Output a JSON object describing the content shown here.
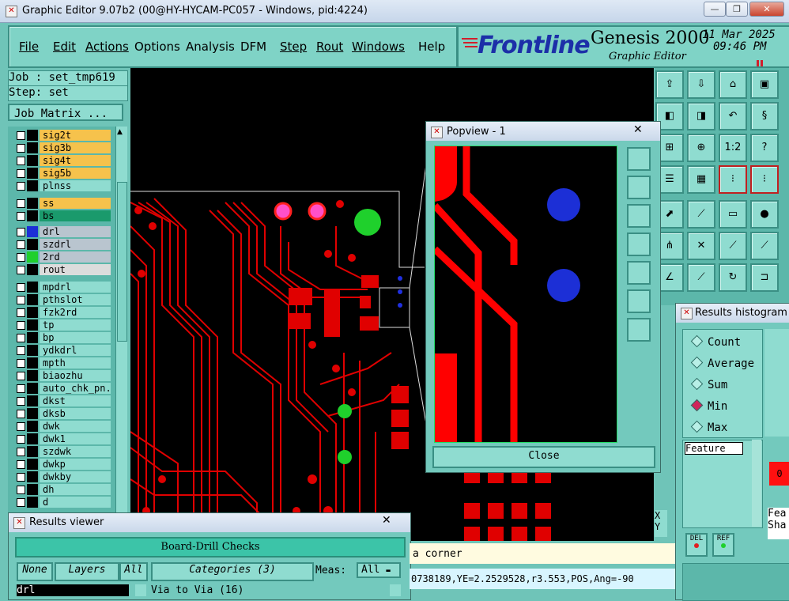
{
  "window": {
    "title": "Graphic Editor 9.07b2 (00@HY-HYCAM-PC057 - Windows, pid:4224)"
  },
  "menu": [
    "File",
    "Edit",
    "Actions",
    "Options",
    "Analysis",
    "DFM",
    "Step",
    "Rout",
    "Windows",
    "Help"
  ],
  "brand": {
    "logo": "Frontline",
    "product": "Genesis 2000",
    "subtitle": "Graphic Editor",
    "date": "11 Mar 2025",
    "time": "09:46 PM"
  },
  "job": {
    "job_label": "Job : set_tmp619",
    "step_label": "Step: set",
    "matrix_button": "Job Matrix ..."
  },
  "layers": [
    {
      "name": "sig2t",
      "color": "#f6c24c",
      "swatch": "#000"
    },
    {
      "name": "sig3b",
      "color": "#f6c24c",
      "swatch": "#000"
    },
    {
      "name": "sig4t",
      "color": "#f6c24c",
      "swatch": "#000"
    },
    {
      "name": "sig5b",
      "color": "#f6c24c",
      "swatch": "#000"
    },
    {
      "name": "plnss",
      "color": "#8fdcd0",
      "swatch": "#000"
    },
    {
      "name": "ss",
      "color": "#f6c24c",
      "swatch": "#000"
    },
    {
      "name": "bs",
      "color": "#1a9a6c",
      "swatch": "#000"
    },
    {
      "name": "drl",
      "color": "#b9c5cf",
      "swatch": "#1c2fd6"
    },
    {
      "name": "szdrl",
      "color": "#b9c5cf",
      "swatch": "#000"
    },
    {
      "name": "2rd",
      "color": "#b9c5cf",
      "swatch": "#1fd02c"
    },
    {
      "name": "rout",
      "color": "#dcdcdc",
      "swatch": "#000"
    },
    {
      "name": "mpdrl",
      "color": "#8fdcd0",
      "swatch": "#000"
    },
    {
      "name": "pthslot",
      "color": "#8fdcd0",
      "swatch": "#000"
    },
    {
      "name": "fzk2rd",
      "color": "#8fdcd0",
      "swatch": "#000"
    },
    {
      "name": "tp",
      "color": "#8fdcd0",
      "swatch": "#000"
    },
    {
      "name": "bp",
      "color": "#8fdcd0",
      "swatch": "#000"
    },
    {
      "name": "ydkdrl",
      "color": "#8fdcd0",
      "swatch": "#000"
    },
    {
      "name": "mpth",
      "color": "#8fdcd0",
      "swatch": "#000"
    },
    {
      "name": "biaozhu",
      "color": "#8fdcd0",
      "swatch": "#000"
    },
    {
      "name": "auto_chk_pn.",
      "color": "#8fdcd0",
      "swatch": "#000"
    },
    {
      "name": "dkst",
      "color": "#8fdcd0",
      "swatch": "#000"
    },
    {
      "name": "dksb",
      "color": "#8fdcd0",
      "swatch": "#000"
    },
    {
      "name": "dwk",
      "color": "#8fdcd0",
      "swatch": "#000"
    },
    {
      "name": "dwk1",
      "color": "#8fdcd0",
      "swatch": "#000"
    },
    {
      "name": "szdwk",
      "color": "#8fdcd0",
      "swatch": "#000"
    },
    {
      "name": "dwkp",
      "color": "#8fdcd0",
      "swatch": "#000"
    },
    {
      "name": "dwkby",
      "color": "#8fdcd0",
      "swatch": "#000"
    },
    {
      "name": "dh",
      "color": "#8fdcd0",
      "swatch": "#000"
    },
    {
      "name": "d",
      "color": "#8fdcd0",
      "swatch": "#000"
    }
  ],
  "popview": {
    "title": "Popview - 1",
    "close_label": "Close"
  },
  "results_viewer": {
    "title": "Results viewer",
    "header": "Board-Drill Checks",
    "none_btn": "None",
    "layers_btn": "Layers",
    "all_btn": "All",
    "categories_btn": "Categories (3)",
    "meas_label": "Meas:",
    "meas_value": "All",
    "layer_value": "drl",
    "category_item": "Via to Via   (16)"
  },
  "histogram": {
    "title": "Results histogram",
    "options": [
      "Count",
      "Average",
      "Sum",
      "Min",
      "Max"
    ],
    "selected": "Min",
    "feature_label": "Feature",
    "del_label": "DEL",
    "ref_label": "REF",
    "right_labels": [
      "Fea",
      "Sha"
    ],
    "count_value": "0"
  },
  "status": {
    "message": "a corner",
    "coords": "0738189,YE=2.2529528,r3.553,POS,Ang=-90",
    "xy_labels": [
      "X",
      "Y"
    ]
  },
  "toolbar_labels": {
    "ratio": "1:2",
    "help": "?"
  }
}
